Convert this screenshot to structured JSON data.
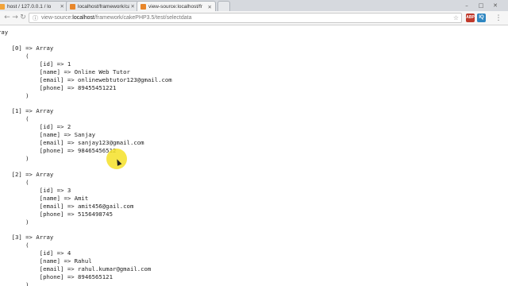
{
  "browser": {
    "tabs": [
      {
        "title": "host / 127.0.0.1 / lo",
        "active": false,
        "icon": "phpmyadmin-icon"
      },
      {
        "title": "localhost/framework/ca",
        "active": false,
        "icon": "page-icon"
      },
      {
        "title": "view-source:localhost/fr",
        "active": true,
        "icon": "page-icon"
      }
    ],
    "address": {
      "url_prefix": "view-source:",
      "url_host": "localhost",
      "url_path": "/framework/cakePHP3.5/test/selectdata"
    },
    "extensions": [
      "ABP",
      "IQ"
    ]
  },
  "source_lines": [
    "ray",
    "",
    "    [0] => Array",
    "        (",
    "            [id] => 1",
    "            [name] => Online Web Tutor",
    "            [email] => onlinewebtutor123@gmail.com",
    "            [phone] => 89455451221",
    "        )",
    "",
    "    [1] => Array",
    "        (",
    "            [id] => 2",
    "            [name] => Sanjay",
    "            [email] => sanjay123@gmail.com",
    "            [phone] => 98465456512",
    "        )",
    "",
    "    [2] => Array",
    "        (",
    "            [id] => 3",
    "            [name] => Amit",
    "            [email] => amit456@gail.com",
    "            [phone] => 5156498745",
    "        )",
    "",
    "    [3] => Array",
    "        (",
    "            [id] => 4",
    "            [name] => Rahul",
    "            [email] => rahul.kumar@gmail.com",
    "            [phone] => 8946565121",
    "        )",
    ""
  ]
}
